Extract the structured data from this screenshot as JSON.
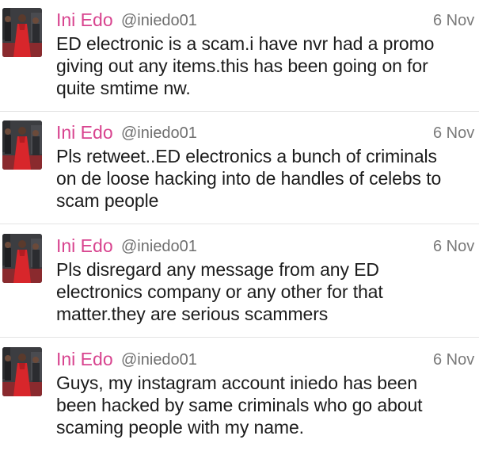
{
  "colors": {
    "name": "#d8448f",
    "handle": "#6f6f6f",
    "time": "#7a7a7a",
    "text": "#1c1c1c",
    "separator": "#e3e3e3"
  },
  "tweets": [
    {
      "name": "Ini Edo",
      "handle": "@iniedo01",
      "time": "6 Nov",
      "lines": [
        "ED electronic is a scam.i have nvr had a promo",
        "giving out any items.this has been going on for",
        "quite smtime nw."
      ],
      "avatar_icon": "profile-photo-avatar"
    },
    {
      "name": "Ini Edo",
      "handle": "@iniedo01",
      "time": "6 Nov",
      "lines": [
        "Pls retweet..ED electronics a bunch of criminals",
        "on de loose hacking into de handles of celebs to",
        "scam people"
      ],
      "avatar_icon": "profile-photo-avatar"
    },
    {
      "name": "Ini Edo",
      "handle": "@iniedo01",
      "time": "6 Nov",
      "lines": [
        "Pls disregard any message from any ED",
        "electronics company or any other for that",
        "matter.they are serious scammers"
      ],
      "avatar_icon": "profile-photo-avatar"
    },
    {
      "name": "Ini Edo",
      "handle": "@iniedo01",
      "time": "6 Nov",
      "lines": [
        "Guys, my instagram account iniedo has been",
        "been hacked by same criminals who go about",
        "scaming people with my name."
      ],
      "avatar_icon": "profile-photo-avatar"
    }
  ]
}
